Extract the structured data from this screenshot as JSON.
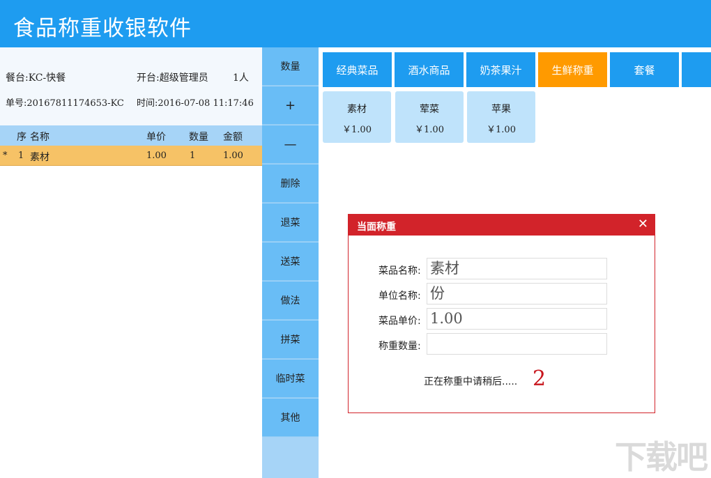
{
  "app": {
    "title": "食品称重收银软件"
  },
  "order": {
    "table_label": "餐台:KC-快餐",
    "opener_label": "开台:超级管理员",
    "guests": "1人",
    "order_no": "单号:20167811174653-KC",
    "time": "时间:2016-07-08 11:17:46",
    "columns": {
      "seq": "序",
      "name": "名称",
      "price": "单价",
      "qty": "数量",
      "amount": "金额"
    },
    "rows": [
      {
        "marker": "*",
        "seq": "1",
        "name": "素材",
        "price": "1.00",
        "qty": "1",
        "amount": "1.00"
      }
    ]
  },
  "functions": [
    "数量",
    "+",
    "—",
    "删除",
    "退菜",
    "送菜",
    "做法",
    "拼菜",
    "临时菜",
    "其他"
  ],
  "categories": [
    {
      "label": "经典菜品",
      "active": false
    },
    {
      "label": "酒水商品",
      "active": false
    },
    {
      "label": "奶茶果汁",
      "active": false
    },
    {
      "label": "生鲜称重",
      "active": true
    },
    {
      "label": "套餐",
      "active": false
    }
  ],
  "products": [
    {
      "name": "素材",
      "price": "￥1.00"
    },
    {
      "name": "荤菜",
      "price": "￥1.00"
    },
    {
      "name": "苹果",
      "price": "￥1.00"
    }
  ],
  "dialog": {
    "title": "当面称重",
    "close_symbol": "✕",
    "fields": [
      {
        "label": "菜品名称:",
        "value": "素材"
      },
      {
        "label": "单位名称:",
        "value": "份"
      },
      {
        "label": "菜品单价:",
        "value": "1.00"
      },
      {
        "label": "称重数量:",
        "value": ""
      }
    ],
    "status": "正在称重中请稍后.....",
    "countdown": "2"
  },
  "watermark": "下载吧",
  "colors": {
    "primary": "#1e9cf0",
    "active_tab": "#ff9a00",
    "dialog_red": "#d2232a",
    "selected_row": "#f6c266"
  }
}
